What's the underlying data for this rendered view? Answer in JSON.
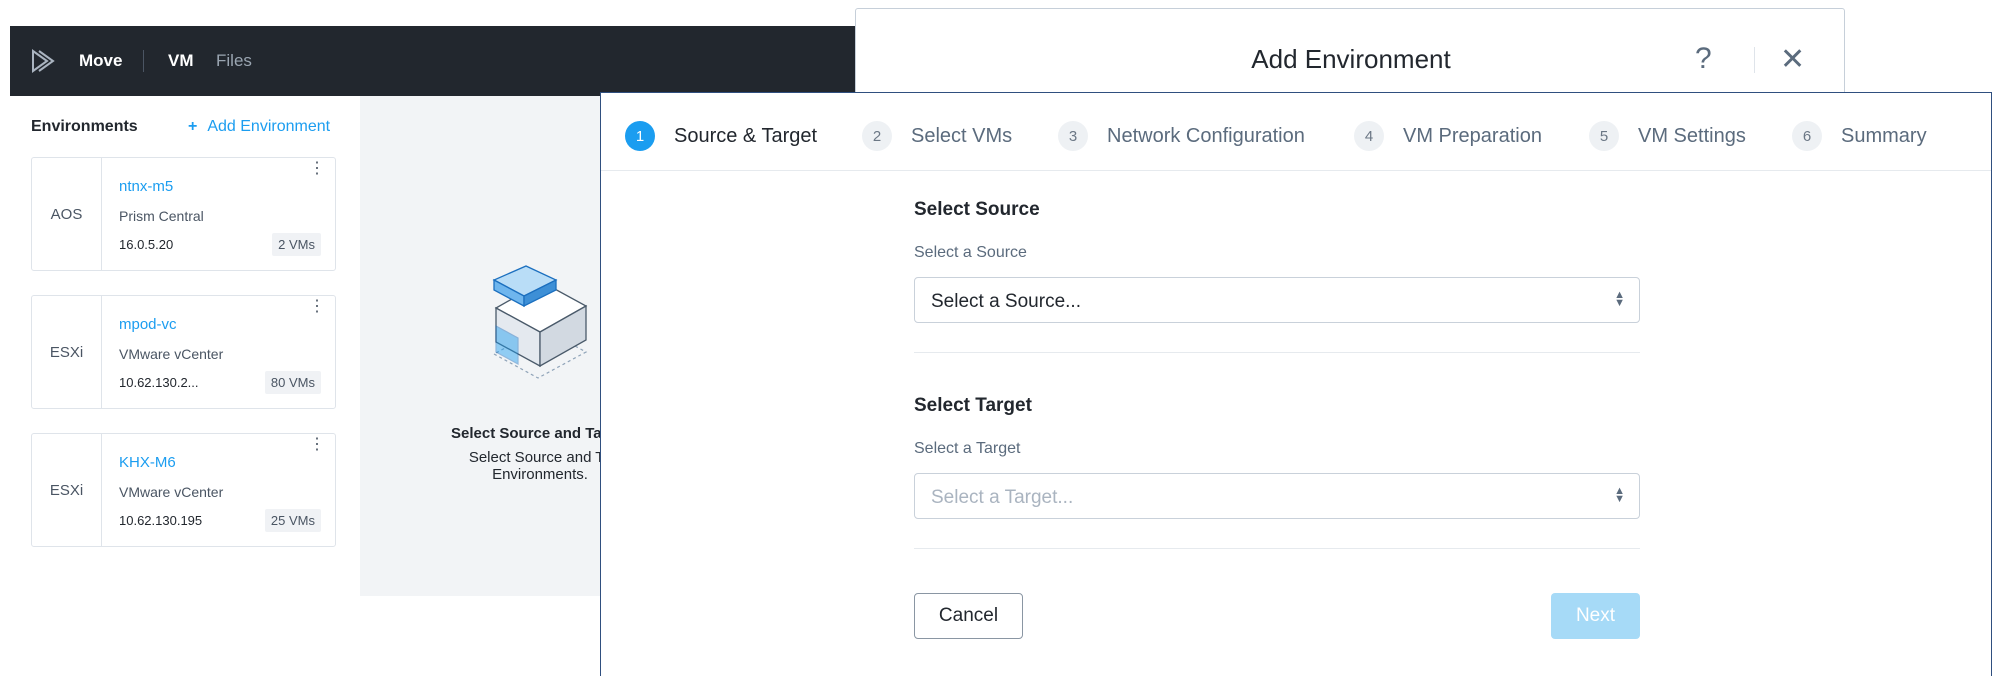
{
  "app": {
    "brand": "Move",
    "nav": {
      "vm": "VM",
      "files": "Files"
    }
  },
  "sidebar": {
    "header": "Environments",
    "add_button": "Add Environment",
    "environments": [
      {
        "type": "AOS",
        "name": "ntnx-m5",
        "kind": "Prism Central",
        "ip": "16.0.5.20",
        "vms": "2 VMs"
      },
      {
        "type": "ESXi",
        "name": "mpod-vc",
        "kind": "VMware vCenter",
        "ip": "10.62.130.2...",
        "vms": "80 VMs"
      },
      {
        "type": "ESXi",
        "name": "KHX-M6",
        "kind": "VMware vCenter",
        "ip": "10.62.130.195",
        "vms": "25 VMs"
      }
    ]
  },
  "empty_state": {
    "title": "Select Source and Ta",
    "description": "Select Source and Ta Environments."
  },
  "modal": {
    "title": "Add Environment",
    "help_glyph": "?",
    "close_glyph": "✕",
    "steps": [
      {
        "number": "1",
        "label": "Source & Target"
      },
      {
        "number": "2",
        "label": "Select VMs"
      },
      {
        "number": "3",
        "label": "Network Configuration"
      },
      {
        "number": "4",
        "label": "VM Preparation"
      },
      {
        "number": "5",
        "label": "VM Settings"
      },
      {
        "number": "6",
        "label": "Summary"
      }
    ],
    "source": {
      "section_title": "Select Source",
      "label": "Select a Source",
      "value": "Select a Source..."
    },
    "target": {
      "section_title": "Select Target",
      "label": "Select a Target",
      "placeholder": "Select a Target..."
    },
    "buttons": {
      "cancel": "Cancel",
      "next": "Next"
    }
  },
  "colors": {
    "accent": "#1b9df0",
    "topbar": "#22272e",
    "next_disabled": "#a6daf7"
  }
}
